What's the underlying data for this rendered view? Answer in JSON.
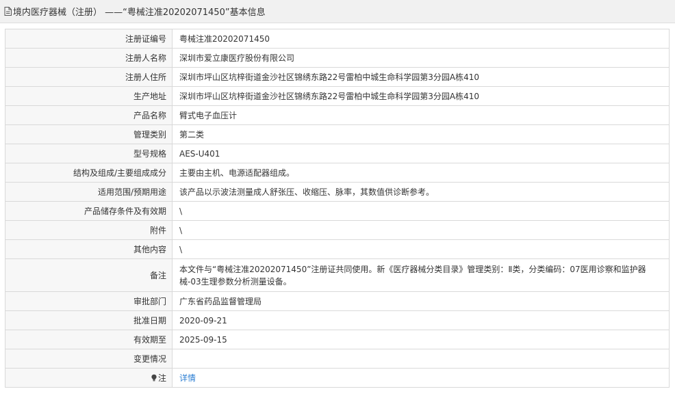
{
  "header": {
    "title": "境内医疗器械（注册） ——“粤械注准20202071450”基本信息",
    "icon": "document-icon"
  },
  "rows": [
    {
      "label": "注册证编号",
      "value": "粤械注准20202071450"
    },
    {
      "label": "注册人名称",
      "value": "深圳市爱立康医疗股份有限公司"
    },
    {
      "label": "注册人住所",
      "value": "深圳市坪山区坑梓街道金沙社区锦绣东路22号雷柏中城生命科学园第3分园A栋410"
    },
    {
      "label": "生产地址",
      "value": "深圳市坪山区坑梓街道金沙社区锦绣东路22号雷柏中城生命科学园第3分园A栋410"
    },
    {
      "label": "产品名称",
      "value": "臂式电子血压计"
    },
    {
      "label": "管理类别",
      "value": "第二类"
    },
    {
      "label": "型号规格",
      "value": "AES-U401"
    },
    {
      "label": "结构及组成/主要组成成分",
      "value": "主要由主机、电源适配器组成。"
    },
    {
      "label": "适用范围/预期用途",
      "value": "该产品以示波法测量成人舒张压、收缩压、脉率，其数值供诊断参考。"
    },
    {
      "label": "产品储存条件及有效期",
      "value": "\\"
    },
    {
      "label": "附件",
      "value": "\\"
    },
    {
      "label": "其他内容",
      "value": "\\"
    },
    {
      "label": "备注",
      "value": "本文件与“粤械注准20202071450”注册证共同使用。新《医疗器械分类目录》管理类别：Ⅱ类，分类编码：07医用诊察和监护器械-03生理参数分析测量设备。"
    },
    {
      "label": "审批部门",
      "value": "广东省药品监督管理局"
    },
    {
      "label": "批准日期",
      "value": "2020-09-21"
    },
    {
      "label": "有效期至",
      "value": "2025-09-15"
    },
    {
      "label": "变更情况",
      "value": ""
    }
  ],
  "note_row": {
    "label": "注",
    "icon": "lightbulb-icon",
    "link_text": "详情"
  }
}
